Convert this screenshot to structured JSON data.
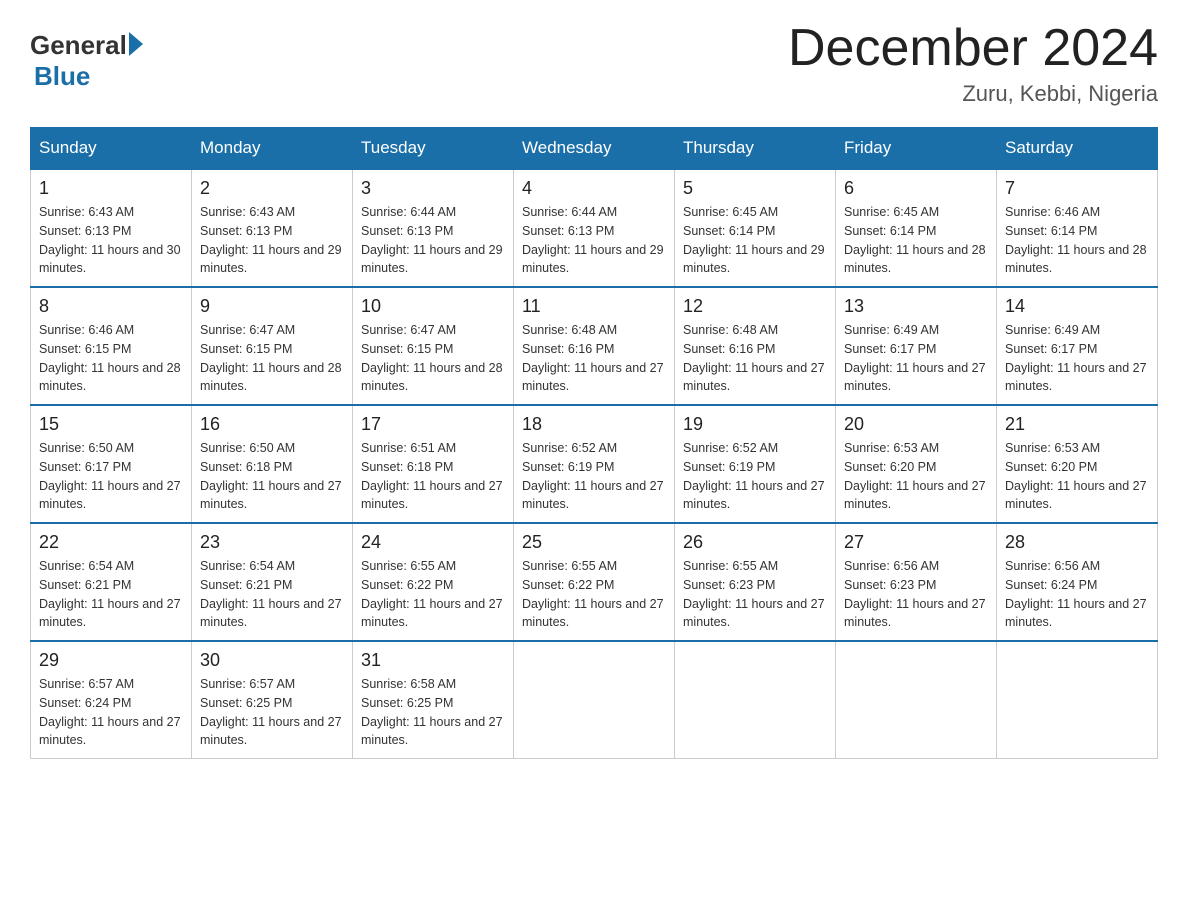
{
  "header": {
    "logo_general": "General",
    "logo_blue": "Blue",
    "month_title": "December 2024",
    "location": "Zuru, Kebbi, Nigeria"
  },
  "weekdays": [
    "Sunday",
    "Monday",
    "Tuesday",
    "Wednesday",
    "Thursday",
    "Friday",
    "Saturday"
  ],
  "weeks": [
    [
      {
        "day": "1",
        "sunrise": "6:43 AM",
        "sunset": "6:13 PM",
        "daylight": "11 hours and 30 minutes."
      },
      {
        "day": "2",
        "sunrise": "6:43 AM",
        "sunset": "6:13 PM",
        "daylight": "11 hours and 29 minutes."
      },
      {
        "day": "3",
        "sunrise": "6:44 AM",
        "sunset": "6:13 PM",
        "daylight": "11 hours and 29 minutes."
      },
      {
        "day": "4",
        "sunrise": "6:44 AM",
        "sunset": "6:13 PM",
        "daylight": "11 hours and 29 minutes."
      },
      {
        "day": "5",
        "sunrise": "6:45 AM",
        "sunset": "6:14 PM",
        "daylight": "11 hours and 29 minutes."
      },
      {
        "day": "6",
        "sunrise": "6:45 AM",
        "sunset": "6:14 PM",
        "daylight": "11 hours and 28 minutes."
      },
      {
        "day": "7",
        "sunrise": "6:46 AM",
        "sunset": "6:14 PM",
        "daylight": "11 hours and 28 minutes."
      }
    ],
    [
      {
        "day": "8",
        "sunrise": "6:46 AM",
        "sunset": "6:15 PM",
        "daylight": "11 hours and 28 minutes."
      },
      {
        "day": "9",
        "sunrise": "6:47 AM",
        "sunset": "6:15 PM",
        "daylight": "11 hours and 28 minutes."
      },
      {
        "day": "10",
        "sunrise": "6:47 AM",
        "sunset": "6:15 PM",
        "daylight": "11 hours and 28 minutes."
      },
      {
        "day": "11",
        "sunrise": "6:48 AM",
        "sunset": "6:16 PM",
        "daylight": "11 hours and 27 minutes."
      },
      {
        "day": "12",
        "sunrise": "6:48 AM",
        "sunset": "6:16 PM",
        "daylight": "11 hours and 27 minutes."
      },
      {
        "day": "13",
        "sunrise": "6:49 AM",
        "sunset": "6:17 PM",
        "daylight": "11 hours and 27 minutes."
      },
      {
        "day": "14",
        "sunrise": "6:49 AM",
        "sunset": "6:17 PM",
        "daylight": "11 hours and 27 minutes."
      }
    ],
    [
      {
        "day": "15",
        "sunrise": "6:50 AM",
        "sunset": "6:17 PM",
        "daylight": "11 hours and 27 minutes."
      },
      {
        "day": "16",
        "sunrise": "6:50 AM",
        "sunset": "6:18 PM",
        "daylight": "11 hours and 27 minutes."
      },
      {
        "day": "17",
        "sunrise": "6:51 AM",
        "sunset": "6:18 PM",
        "daylight": "11 hours and 27 minutes."
      },
      {
        "day": "18",
        "sunrise": "6:52 AM",
        "sunset": "6:19 PM",
        "daylight": "11 hours and 27 minutes."
      },
      {
        "day": "19",
        "sunrise": "6:52 AM",
        "sunset": "6:19 PM",
        "daylight": "11 hours and 27 minutes."
      },
      {
        "day": "20",
        "sunrise": "6:53 AM",
        "sunset": "6:20 PM",
        "daylight": "11 hours and 27 minutes."
      },
      {
        "day": "21",
        "sunrise": "6:53 AM",
        "sunset": "6:20 PM",
        "daylight": "11 hours and 27 minutes."
      }
    ],
    [
      {
        "day": "22",
        "sunrise": "6:54 AM",
        "sunset": "6:21 PM",
        "daylight": "11 hours and 27 minutes."
      },
      {
        "day": "23",
        "sunrise": "6:54 AM",
        "sunset": "6:21 PM",
        "daylight": "11 hours and 27 minutes."
      },
      {
        "day": "24",
        "sunrise": "6:55 AM",
        "sunset": "6:22 PM",
        "daylight": "11 hours and 27 minutes."
      },
      {
        "day": "25",
        "sunrise": "6:55 AM",
        "sunset": "6:22 PM",
        "daylight": "11 hours and 27 minutes."
      },
      {
        "day": "26",
        "sunrise": "6:55 AM",
        "sunset": "6:23 PM",
        "daylight": "11 hours and 27 minutes."
      },
      {
        "day": "27",
        "sunrise": "6:56 AM",
        "sunset": "6:23 PM",
        "daylight": "11 hours and 27 minutes."
      },
      {
        "day": "28",
        "sunrise": "6:56 AM",
        "sunset": "6:24 PM",
        "daylight": "11 hours and 27 minutes."
      }
    ],
    [
      {
        "day": "29",
        "sunrise": "6:57 AM",
        "sunset": "6:24 PM",
        "daylight": "11 hours and 27 minutes."
      },
      {
        "day": "30",
        "sunrise": "6:57 AM",
        "sunset": "6:25 PM",
        "daylight": "11 hours and 27 minutes."
      },
      {
        "day": "31",
        "sunrise": "6:58 AM",
        "sunset": "6:25 PM",
        "daylight": "11 hours and 27 minutes."
      },
      null,
      null,
      null,
      null
    ]
  ]
}
